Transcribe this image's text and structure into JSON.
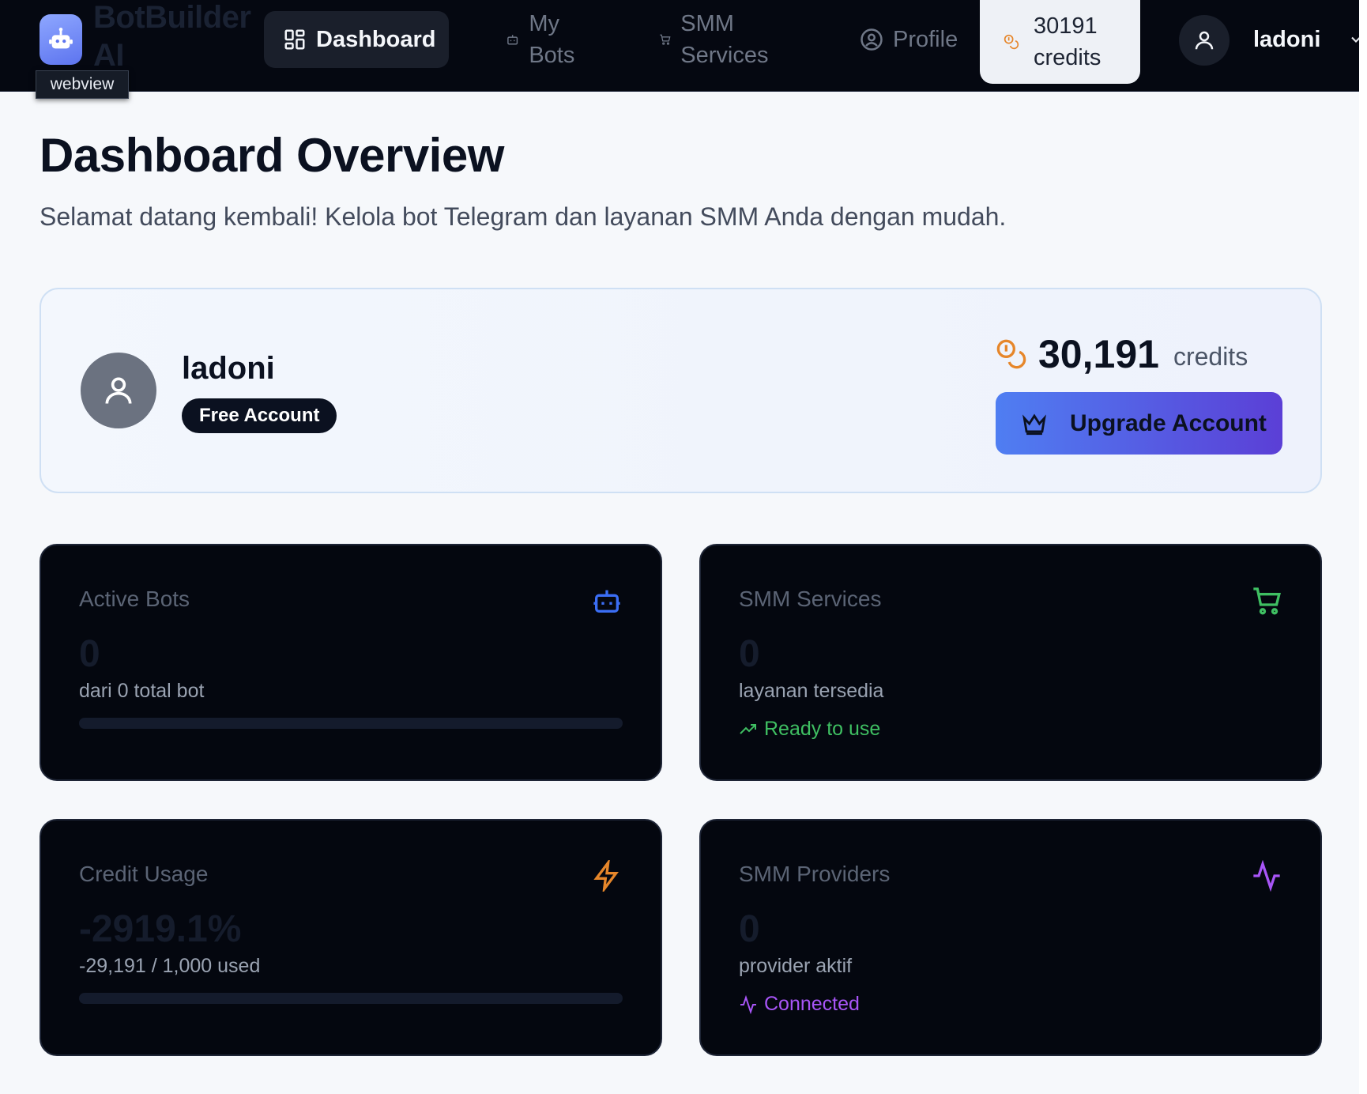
{
  "nav": {
    "brand": "BotBuilder AI",
    "tooltip": "webview",
    "tabs": [
      {
        "label": "Dashboard",
        "icon": "dashboard-grid-icon",
        "active": true
      },
      {
        "label": "My Bots",
        "icon": "bot-icon",
        "active": false
      },
      {
        "label": "SMM Services",
        "icon": "cart-icon",
        "active": false
      },
      {
        "label": "Profile",
        "icon": "user-circle-icon",
        "active": false
      }
    ],
    "credits_label": "30191 credits",
    "user_name": "ladoni"
  },
  "header": {
    "title": "Dashboard Overview",
    "subtitle": "Selamat datang kembali! Kelola bot Telegram dan layanan SMM Anda dengan mudah."
  },
  "profile_card": {
    "name": "ladoni",
    "account_type": "Free Account",
    "credit_amount": "30,191",
    "credit_unit": "credits",
    "upgrade_label": "Upgrade Account"
  },
  "stats": [
    {
      "title": "Active Bots",
      "value": "0",
      "description": "dari 0 total bot",
      "icon": "bot-icon",
      "icon_color": "#3b6ef5",
      "progress": 0
    },
    {
      "title": "SMM Services",
      "value": "0",
      "description": "layanan tersedia",
      "status": "Ready to use",
      "icon": "cart-icon",
      "icon_color": "#3fbf62"
    },
    {
      "title": "Credit Usage",
      "value": "-2919.1%",
      "description": "-29,191 / 1,000 used",
      "icon": "lightning-icon",
      "icon_color": "#e6862a",
      "progress": 0
    },
    {
      "title": "SMM Providers",
      "value": "0",
      "description": "provider aktif",
      "status": "Connected",
      "icon": "activity-icon",
      "icon_color": "#a855f7"
    }
  ],
  "colors": {
    "nav_bg": "#050811",
    "card_bg": "#04070f",
    "accent_blue": "#4f7ef2",
    "accent_purple": "#5b3fd6",
    "credit_orange": "#e6862a"
  }
}
